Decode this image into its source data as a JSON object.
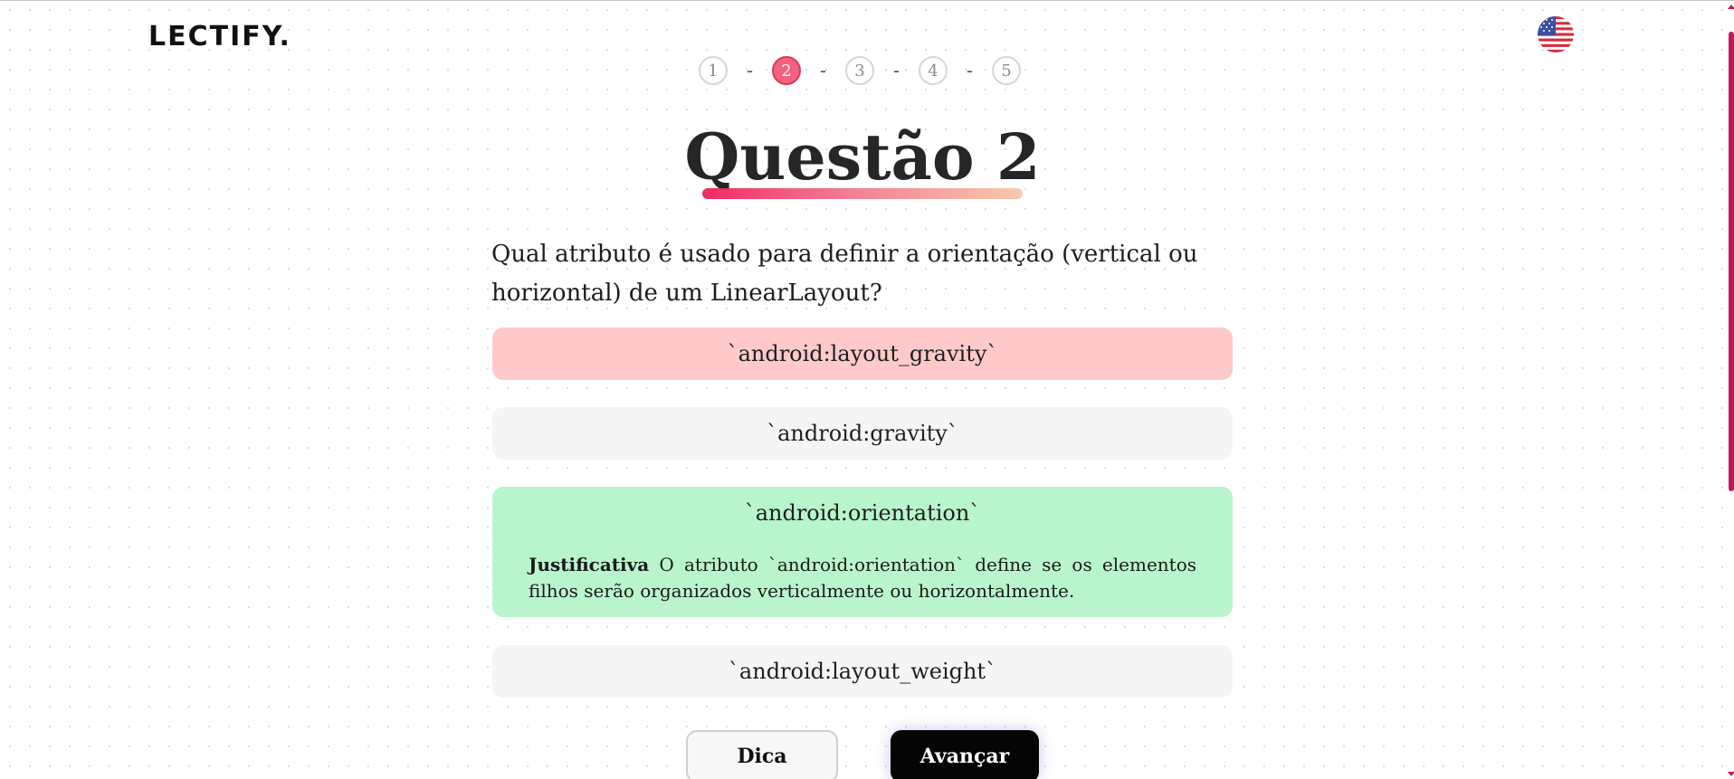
{
  "brand": {
    "logo": "LECTIFY."
  },
  "language": {
    "icon": "us-flag-icon"
  },
  "stepper": {
    "steps": [
      "1",
      "2",
      "3",
      "4",
      "5"
    ],
    "separator": "-",
    "active": 2
  },
  "question": {
    "title": "Questão 2",
    "text": "Qual atributo é usado para definir a orientação (vertical ou horizontal) de um LinearLayout?"
  },
  "options": [
    {
      "label": "`android:layout_gravity`",
      "state": "wrong"
    },
    {
      "label": "`android:gravity`",
      "state": "neutral"
    },
    {
      "label": "`android:orientation`",
      "state": "correct"
    },
    {
      "label": "`android:layout_weight`",
      "state": "neutral"
    }
  ],
  "justification": {
    "label": "Justificativa",
    "text": "O atributo `android:orientation` define se os elementos filhos serão organizados verticalmente ou horizontalmente."
  },
  "buttons": {
    "hint": "Dica",
    "next": "Avançar"
  },
  "colors": {
    "wrong": "#ffc9c9",
    "correct": "#b8f5cc",
    "neutral": "#f5f5f5",
    "accent": "#f4617f",
    "scrollbar": "#c2185b"
  }
}
